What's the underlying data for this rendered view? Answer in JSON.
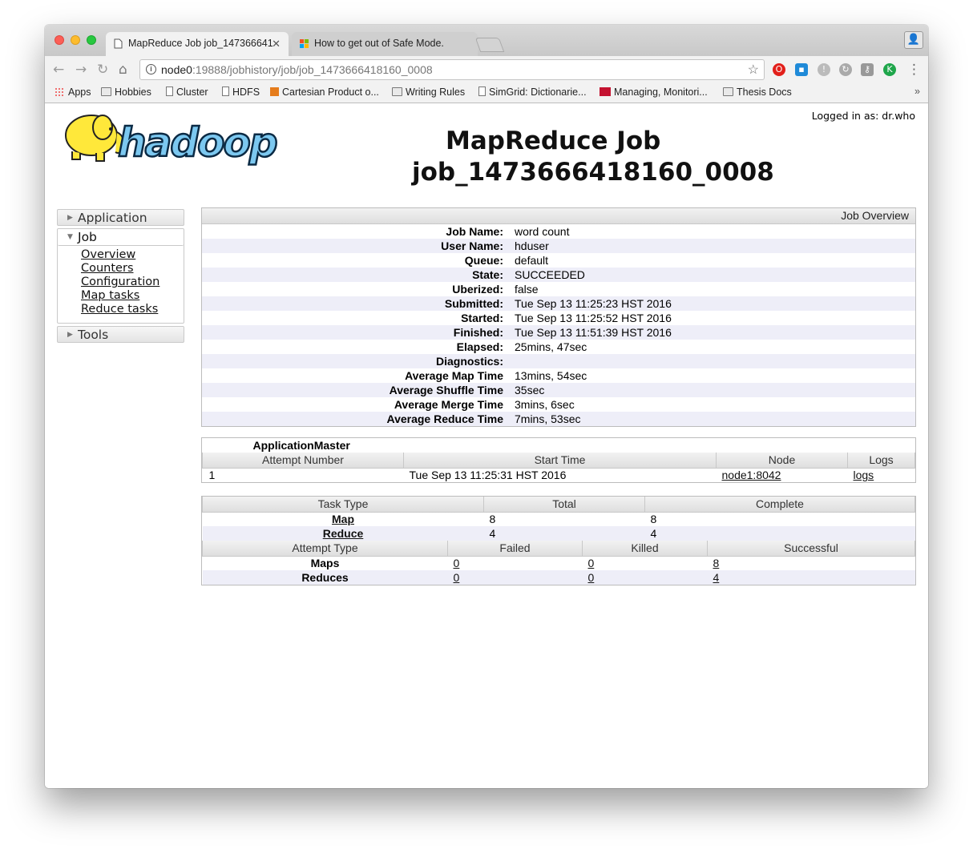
{
  "browser": {
    "tabs": [
      {
        "title": "MapReduce Job job_147366641",
        "active": true
      },
      {
        "title": "How to get out of Safe Mode.",
        "active": false
      }
    ],
    "url_host": "node0",
    "url_path": ":19888/jobhistory/job/job_1473666418160_0008",
    "bookmarks": [
      "Apps",
      "Hobbies",
      "Cluster",
      "HDFS",
      "Cartesian Product o...",
      "Writing Rules",
      "SimGrid: Dictionarie...",
      "Managing, Monitori...",
      "Thesis Docs"
    ],
    "more_label": "»"
  },
  "header": {
    "logged_in": "Logged in as: dr.who",
    "logo_text": "hadoop",
    "title_line1": "MapReduce Job",
    "title_line2": "job_1473666418160_0008"
  },
  "nav": {
    "application": "Application",
    "job": "Job",
    "links": [
      "Overview",
      "Counters",
      "Configuration",
      "Map tasks",
      "Reduce tasks"
    ],
    "tools": "Tools"
  },
  "overview": {
    "heading": "Job Overview",
    "rows": [
      {
        "label": "Job Name:",
        "value": "word count"
      },
      {
        "label": "User Name:",
        "value": "hduser"
      },
      {
        "label": "Queue:",
        "value": "default"
      },
      {
        "label": "State:",
        "value": "SUCCEEDED"
      },
      {
        "label": "Uberized:",
        "value": "false"
      },
      {
        "label": "Submitted:",
        "value": "Tue Sep 13 11:25:23 HST 2016"
      },
      {
        "label": "Started:",
        "value": "Tue Sep 13 11:25:52 HST 2016"
      },
      {
        "label": "Finished:",
        "value": "Tue Sep 13 11:51:39 HST 2016"
      },
      {
        "label": "Elapsed:",
        "value": "25mins, 47sec"
      },
      {
        "label": "Diagnostics:",
        "value": ""
      },
      {
        "label": "Average Map Time",
        "value": "13mins, 54sec"
      },
      {
        "label": "Average Shuffle Time",
        "value": "35sec"
      },
      {
        "label": "Average Merge Time",
        "value": "3mins, 6sec"
      },
      {
        "label": "Average Reduce Time",
        "value": "7mins, 53sec"
      }
    ]
  },
  "am": {
    "title": "ApplicationMaster",
    "headers": [
      "Attempt Number",
      "Start Time",
      "Node",
      "Logs"
    ],
    "row": {
      "attempt": "1",
      "start": "Tue Sep 13 11:25:31 HST 2016",
      "node": "node1:8042",
      "logs": "logs"
    }
  },
  "tasks": {
    "headers": [
      "Task Type",
      "Total",
      "Complete"
    ],
    "rows": [
      {
        "type": "Map",
        "total": "8",
        "complete": "8"
      },
      {
        "type": "Reduce",
        "total": "4",
        "complete": "4"
      }
    ],
    "attempt_headers": [
      "Attempt Type",
      "Failed",
      "Killed",
      "Successful"
    ],
    "attempt_rows": [
      {
        "type": "Maps",
        "failed": "0",
        "killed": "0",
        "successful": "8"
      },
      {
        "type": "Reduces",
        "failed": "0",
        "killed": "0",
        "successful": "4"
      }
    ]
  }
}
